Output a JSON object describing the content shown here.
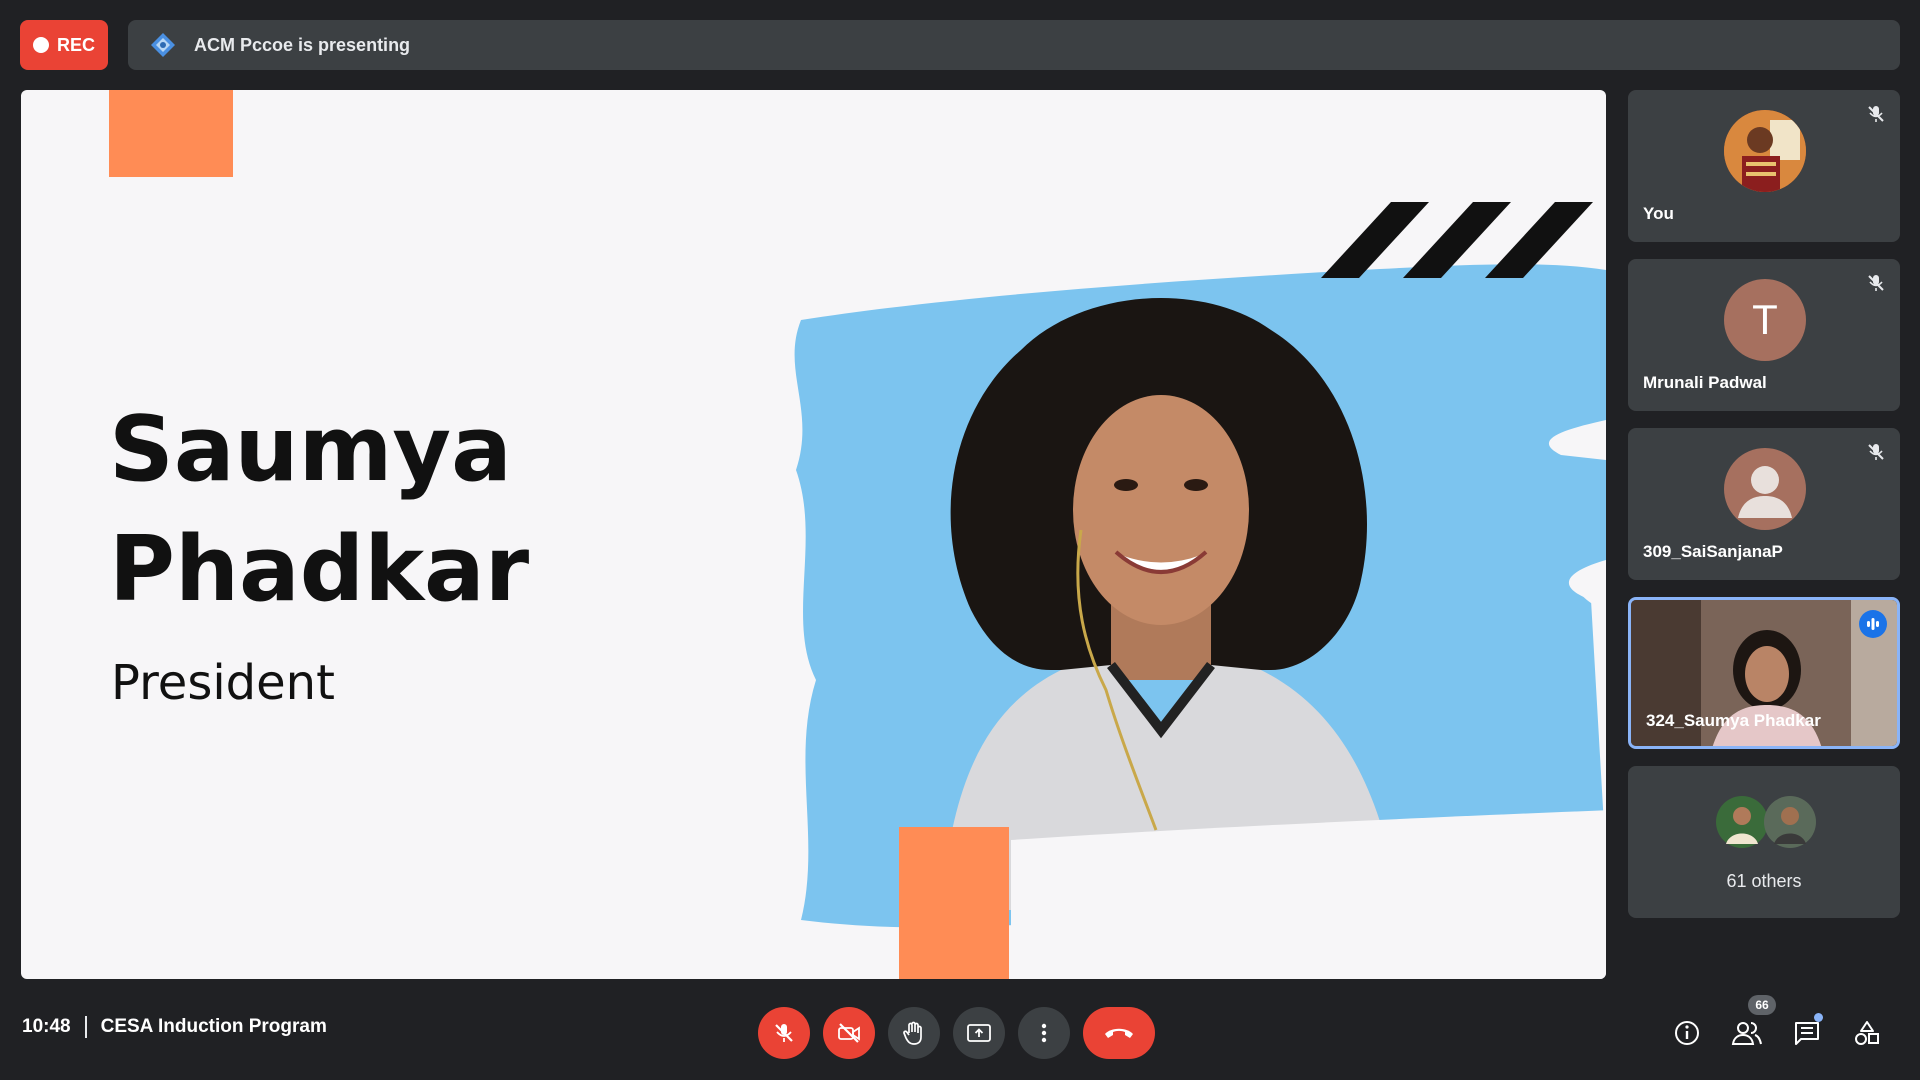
{
  "top": {
    "rec_label": "REC",
    "presenting_text": "ACM Pccoe is presenting",
    "presenter_icon": "acm-logo-icon"
  },
  "slide": {
    "name_line1": "Saumya",
    "name_line2": "Phadkar",
    "role": "President",
    "colors": {
      "accent_orange": "#ff8c55",
      "brush_blue": "#7cc4ef"
    }
  },
  "participants": [
    {
      "name": "You",
      "muted": true,
      "avatar": "photo"
    },
    {
      "name": "Mrunali Padwal",
      "muted": true,
      "avatar_letter": "T",
      "avatar_color": "#a6705f"
    },
    {
      "name": "309_SaiSanjanaP",
      "muted": true,
      "avatar": "default-person"
    },
    {
      "name": "324_Saumya Phadkar",
      "speaking": true,
      "avatar": "video"
    }
  ],
  "others": {
    "label": "61 others"
  },
  "bottom": {
    "time": "10:48",
    "meeting_title": "CESA Induction Program",
    "people_count": "66"
  },
  "colors": {
    "background": "#202124",
    "tile": "#3c4043",
    "red": "#ea4335",
    "blue": "#1a73e8"
  }
}
